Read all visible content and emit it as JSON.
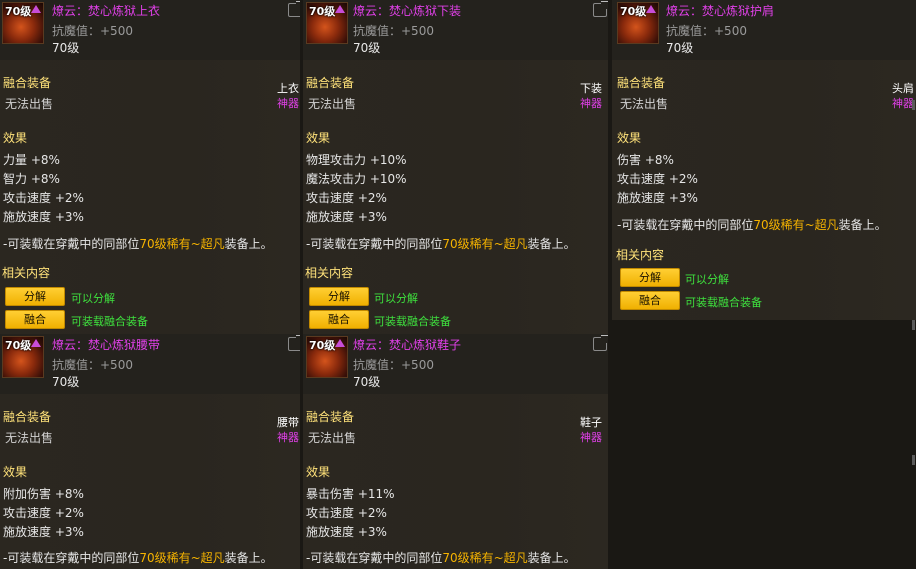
{
  "common": {
    "fusion_title": "融合装备",
    "unsellable": "无法出售",
    "effects_title": "效果",
    "related_title": "相关内容",
    "rarity_mythic": "神器",
    "note_prefix": "-可装载在穿戴中的同部位",
    "note_highlight": "70级稀有~超凡",
    "note_suffix": "装备上。",
    "btn_disassemble": "分解",
    "btn_disassemble_desc": "可以分解",
    "btn_fuse": "融合",
    "btn_fuse_desc": "可装载融合装备",
    "icon_level": "70级"
  },
  "items": [
    {
      "name": "燎云：焚心炼狱上衣",
      "stat": "抗魔值：+500",
      "level": "70级",
      "slot": "上衣",
      "effects": [
        "力量 +8%",
        "智力 +8%",
        "攻击速度 +2%",
        "施放速度 +3%"
      ]
    },
    {
      "name": "燎云：焚心炼狱下装",
      "stat": "抗魔值：+500",
      "level": "70级",
      "slot": "下装",
      "effects": [
        "物理攻击力 +10%",
        "魔法攻击力 +10%",
        "攻击速度 +2%",
        "施放速度 +3%"
      ]
    },
    {
      "name": "燎云：焚心炼狱护肩",
      "stat": "抗魔值：+500",
      "level": "70级",
      "slot": "头肩",
      "effects": [
        "伤害 +8%",
        "攻击速度 +2%",
        "施放速度 +3%"
      ]
    },
    {
      "name": "燎云：焚心炼狱腰带",
      "stat": "抗魔值：+500",
      "level": "70级",
      "slot": "腰带",
      "effects": [
        "附加伤害 +8%",
        "攻击速度 +2%",
        "施放速度 +3%"
      ]
    },
    {
      "name": "燎云：焚心炼狱鞋子",
      "stat": "抗魔值：+500",
      "level": "70级",
      "slot": "鞋子",
      "effects": [
        "暴击伤害 +11%",
        "攻击速度 +2%",
        "施放速度 +3%"
      ]
    }
  ],
  "colors": {
    "item_name": "#e040e8",
    "section_title": "#ffe27a",
    "highlight": "#f5b300",
    "button": "#f0b000",
    "green_desc": "#3ee13e"
  }
}
